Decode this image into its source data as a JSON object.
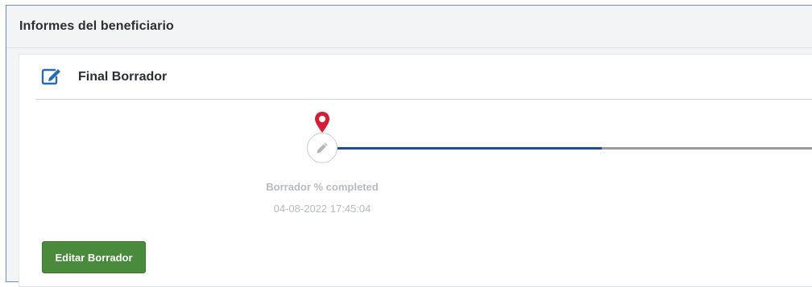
{
  "panel": {
    "title": "Informes del beneficiario"
  },
  "card": {
    "title": "Final Borrador",
    "title_icon": "edit-square-icon",
    "accent_color": "#2a6ab3"
  },
  "timeline": {
    "steps": [
      {
        "label": "Borrador % completed",
        "date": "04-08-2022 17:45:04",
        "icon": "pencil-icon",
        "marker": "map-pin-icon"
      }
    ],
    "progress_color": "#1f4f8c",
    "pending_color": "#9a9a9a",
    "marker_color": "#d21f35"
  },
  "actions": {
    "edit_label": "Editar Borrador",
    "button_color": "#4a8a3c"
  }
}
